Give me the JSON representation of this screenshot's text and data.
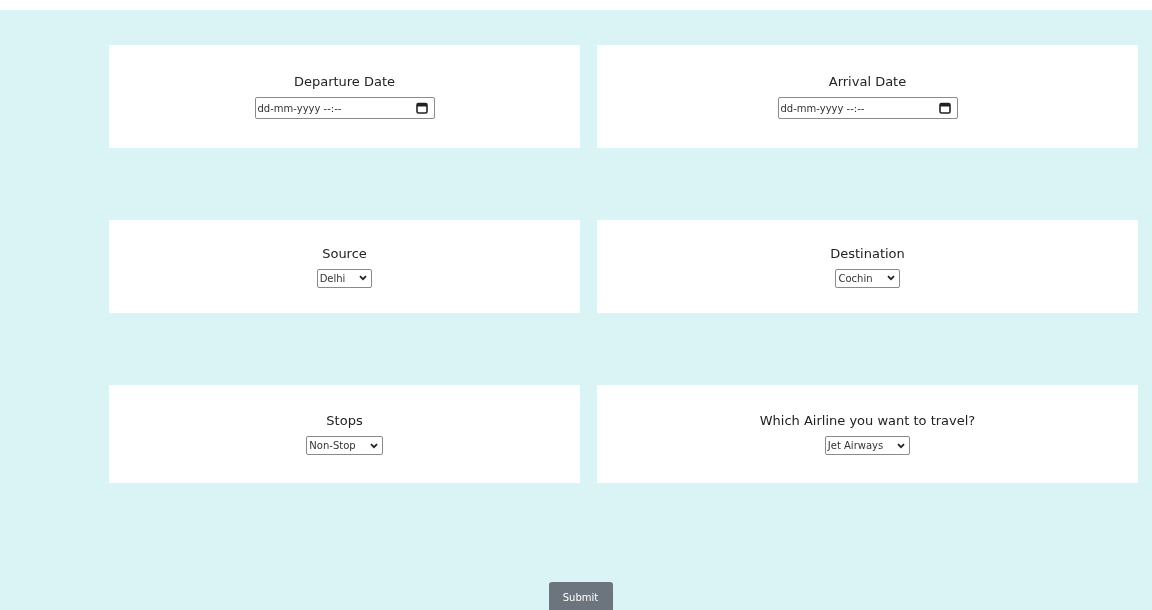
{
  "cards": [
    {
      "label": "Departure Date",
      "field": {
        "kind": "date",
        "placeholder": "dd-mm-yyyy --:--"
      }
    },
    {
      "label": "Arrival Date",
      "field": {
        "kind": "date",
        "placeholder": "dd-mm-yyyy --:--"
      }
    },
    {
      "label": "Source",
      "field": {
        "kind": "select",
        "value": "Delhi"
      }
    },
    {
      "label": "Destination",
      "field": {
        "kind": "select",
        "value": "Cochin"
      }
    },
    {
      "label": "Stops",
      "field": {
        "kind": "select",
        "value": "Non-Stop"
      }
    },
    {
      "label": "Which Airline you want to travel?",
      "field": {
        "kind": "select",
        "value": "Jet Airways"
      }
    }
  ],
  "submit": {
    "label": "Submit"
  }
}
